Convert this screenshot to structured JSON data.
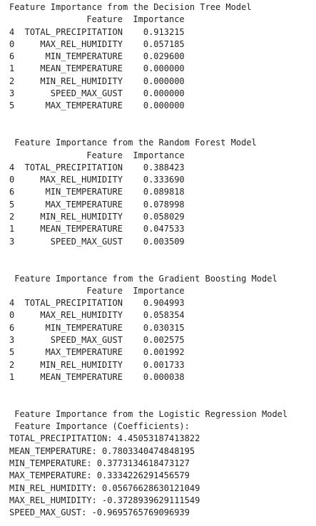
{
  "output": {
    "blocks": [
      {
        "lines": [
          "Feature Importance from the Decision Tree Model",
          "               Feature  Importance",
          "4  TOTAL_PRECIPITATION    0.913215",
          "0     MAX_REL_HUMIDITY    0.057185",
          "6      MIN_TEMPERATURE    0.029600",
          "1     MEAN_TEMPERATURE    0.000000",
          "2     MIN_REL_HUMIDITY    0.000000",
          "3       SPEED_MAX_GUST    0.000000",
          "5      MAX_TEMPERATURE    0.000000"
        ]
      },
      {
        "lines": [
          " Feature Importance from the Random Forest Model",
          "               Feature  Importance",
          "4  TOTAL_PRECIPITATION    0.388423",
          "0     MAX_REL_HUMIDITY    0.333690",
          "6      MIN_TEMPERATURE    0.089818",
          "5      MAX_TEMPERATURE    0.078998",
          "2     MIN_REL_HUMIDITY    0.058029",
          "1     MEAN_TEMPERATURE    0.047533",
          "3       SPEED_MAX_GUST    0.003509"
        ]
      },
      {
        "lines": [
          " Feature Importance from the Gradient Boosting Model",
          "               Feature  Importance",
          "4  TOTAL_PRECIPITATION    0.904993",
          "0     MAX_REL_HUMIDITY    0.058354",
          "6      MIN_TEMPERATURE    0.030315",
          "3       SPEED_MAX_GUST    0.002575",
          "5      MAX_TEMPERATURE    0.001992",
          "2     MIN_REL_HUMIDITY    0.001733",
          "1     MEAN_TEMPERATURE    0.000038"
        ]
      },
      {
        "lines": [
          " Feature Importance from the Logistic Regression Model",
          " Feature Importance (Coefficients):",
          "TOTAL_PRECIPITATION: 4.45053187413822",
          "MEAN_TEMPERATURE: 0.7803340474848195",
          "MIN_TEMPERATURE: 0.3773134618473127",
          "MAX_TEMPERATURE: 0.3334226291456579",
          "MIN_REL_HUMIDITY: 0.05676628630121049",
          "MAX_REL_HUMIDITY: -0.3728939629111549",
          "SPEED_MAX_GUST: -0.9695765769096939"
        ]
      }
    ]
  }
}
